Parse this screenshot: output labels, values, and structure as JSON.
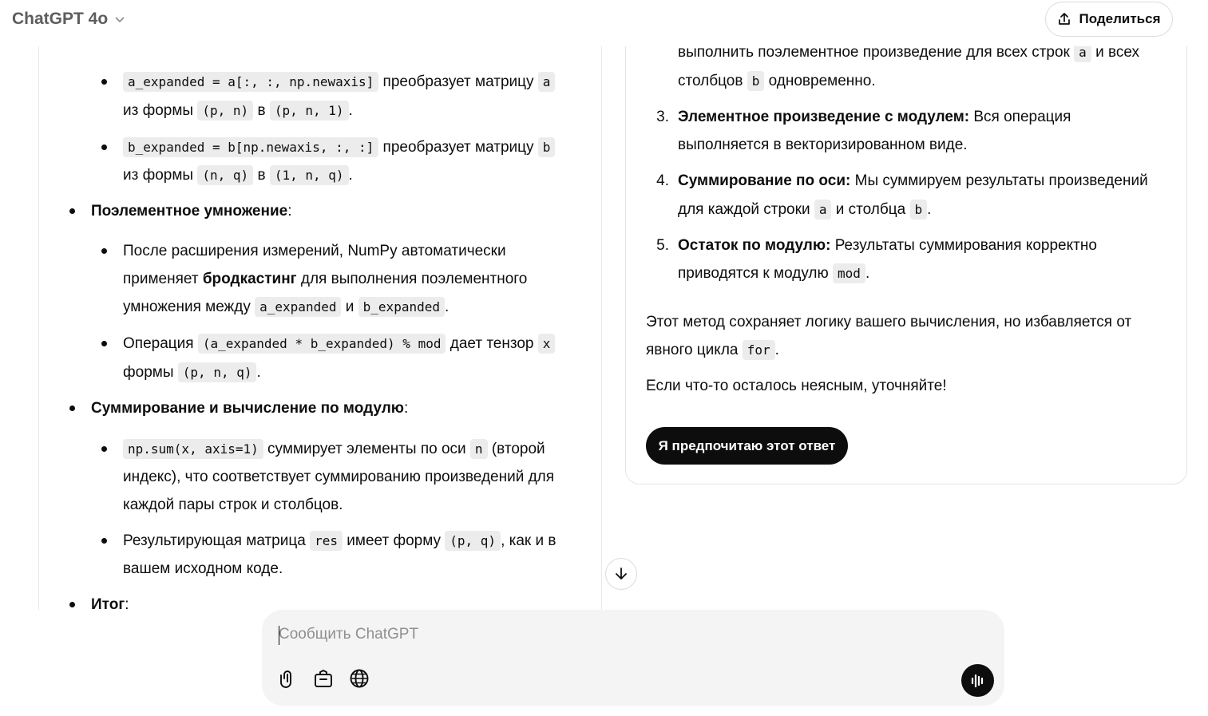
{
  "header": {
    "model": "ChatGPT 4o",
    "share_label": "Поделиться"
  },
  "left": {
    "b1a_code": "a_expanded = a[:, :, np.newaxis]",
    "b1a_text": "преобразует матрицу",
    "var_a": "a",
    "from_form": "из формы",
    "shape_pn": "(p, n)",
    "to": "в",
    "shape_pn1": "(p, n, 1)",
    "period": ".",
    "b1b_code": "b_expanded = b[np.newaxis, :, :]",
    "var_b": "b",
    "shape_nq": "(n, q)",
    "shape_1nq": "(1, n, q)",
    "mult_title": "Поэлементное умножение",
    "colon": ":",
    "mult_l1": "После расширения измерений, NumPy автоматически",
    "mult_l2_pre": "применяет",
    "mult_l2_bold": "бродкастинг",
    "mult_l2_post": "для выполнения поэлементного",
    "mult_l3_pre": "умножения между",
    "a_expanded": "a_expanded",
    "and": "и",
    "b_expanded": "b_expanded",
    "op_pre": "Операция",
    "op_code": "(a_expanded * b_expanded) % mod",
    "op_post": "дает тензор",
    "var_x": "x",
    "op_l2_pre": "формы",
    "shape_pnq": "(p, n, q)",
    "sum_title": "Суммирование и вычисление по модулю",
    "sum_code": "np.sum(x, axis=1)",
    "sum_l1_post": "суммирует элементы по оси",
    "var_n": "n",
    "sum_l1_end": "(второй",
    "sum_l2": "индекс), что соответствует суммированию произведений для",
    "sum_l3": "каждой пары строк и столбцов.",
    "res_pre": "Результирующая матрица",
    "res_code": "res",
    "res_mid": "имеет форму",
    "shape_pq": "(p, q)",
    "res_post": ", как и в",
    "res_l2": "вашем исходном коде.",
    "itog": "Итог"
  },
  "right": {
    "top_l1": "выполнить поэлементное произведение для всех строк",
    "var_a": "a",
    "top_l1_end": "и всех",
    "top_l2_pre": "столбцов",
    "var_b": "b",
    "top_l2_post": "одновременно.",
    "items": [
      {
        "num": "3.",
        "title": "Элементное произведение с модулем:",
        "text": "Вся операция",
        "l2": "выполняется в векторизированном виде."
      },
      {
        "num": "4.",
        "title": "Суммирование по оси:",
        "text": "Мы суммируем результаты произведений",
        "l2_pre": "для каждой строки",
        "l2_mid": "и столбца"
      },
      {
        "num": "5.",
        "title": "Остаток по модулю:",
        "text": "Результаты суммирования корректно",
        "l2_pre": "приводятся к модулю",
        "code": "mod"
      }
    ],
    "period": ".",
    "para1_l1": "Этот метод сохраняет логику вашего вычисления, но избавляется от",
    "para1_l2_pre": "явного цикла",
    "for_code": "for",
    "para2": "Если что-то осталось неясным, уточняйте!",
    "prefer_label": "Я предпочитаю этот ответ"
  },
  "composer": {
    "placeholder": "Сообщить ChatGPT"
  }
}
